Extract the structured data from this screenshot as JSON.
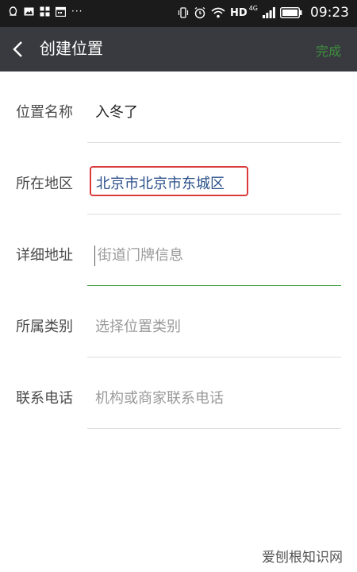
{
  "status_bar": {
    "icons": [
      "qq-icon",
      "image-icon",
      "apps-icon",
      "calendar-icon",
      "more-dots",
      "vibrate-icon",
      "alarm-icon",
      "wifi-icon",
      "signal-icon",
      "battery-icon"
    ],
    "dots": "···",
    "network": "HD",
    "network_sub": "4G",
    "time": "09:23"
  },
  "nav": {
    "back_icon": "chevron-left-icon",
    "title": "创建位置",
    "done_label": "完成",
    "done_color": "#3d8f3d"
  },
  "form": {
    "name": {
      "label": "位置名称",
      "value": "入冬了"
    },
    "region": {
      "label": "所在地区",
      "value": "北京市北京市东城区"
    },
    "address": {
      "label": "详细地址",
      "placeholder": "街道门牌信息"
    },
    "category": {
      "label": "所属类别",
      "placeholder": "选择位置类别"
    },
    "phone": {
      "label": "联系电话",
      "placeholder": "机构或商家联系电话"
    }
  },
  "watermark": "爱刨根知识网",
  "colors": {
    "nav_bg": "#393a3f",
    "highlight_border": "#d93a3a",
    "active_underline": "#3a9c3a"
  }
}
